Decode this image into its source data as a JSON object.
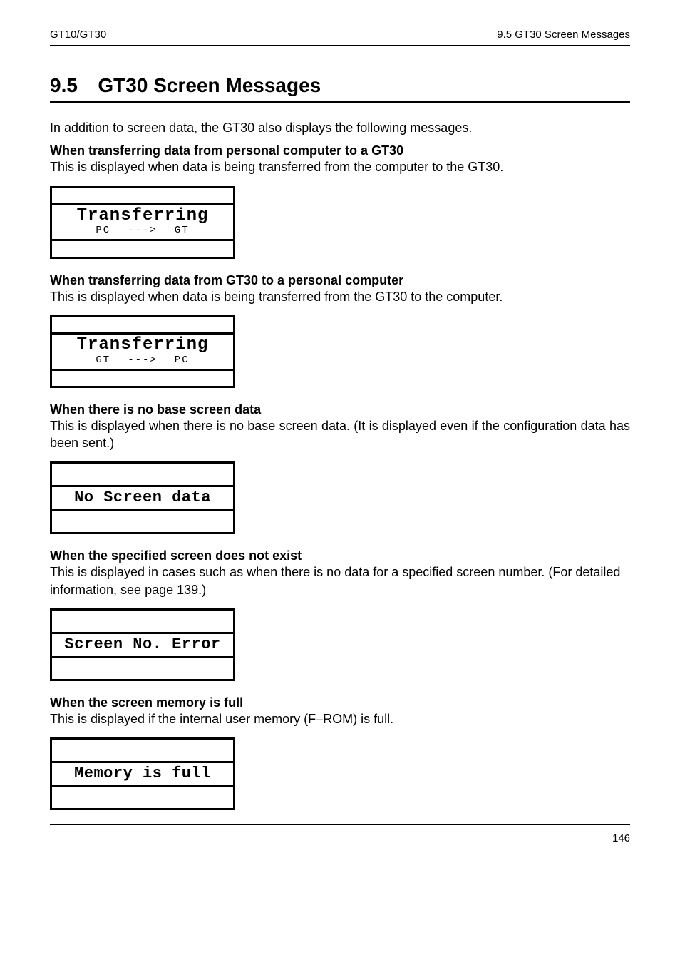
{
  "header": {
    "left": "GT10/GT30",
    "right": "9.5   GT30 Screen Messages"
  },
  "section": {
    "num": "9.5",
    "title": "GT30 Screen Messages"
  },
  "intro": "In addition to screen data, the GT30 also displays the following messages.",
  "blocks": [
    {
      "heading": "When transferring data from personal computer to a GT30",
      "para": "This is displayed when data is being transferred from the computer to the GT30.",
      "lcd": {
        "type": "transfer",
        "main": "Transferring",
        "from": "PC",
        "arrow": "--->",
        "to": "GT"
      }
    },
    {
      "heading": "When transferring data from GT30 to a personal computer",
      "para": "This is displayed when data is being transferred from the GT30 to the computer.",
      "lcd": {
        "type": "transfer",
        "main": "Transferring",
        "from": "GT",
        "arrow": "--->",
        "to": "PC"
      }
    },
    {
      "heading": "When there is no base screen data",
      "para": "This is displayed when there is no base screen data. (It is displayed even if the configuration data has been sent.)",
      "justify": true,
      "lcd": {
        "type": "single",
        "text": "No Screen data"
      }
    },
    {
      "heading": "When the specified screen does not exist",
      "para": "This is displayed in cases such as when there is no data for a specified screen number. (For detailed information, see page 139.)",
      "lcd": {
        "type": "single",
        "text": "Screen No. Error"
      }
    },
    {
      "heading": "When the screen memory is full",
      "para": "This is displayed if the internal user memory (F–ROM) is full.",
      "lcd": {
        "type": "single",
        "text": "Memory is full"
      }
    }
  ],
  "footer": {
    "page": "146"
  }
}
